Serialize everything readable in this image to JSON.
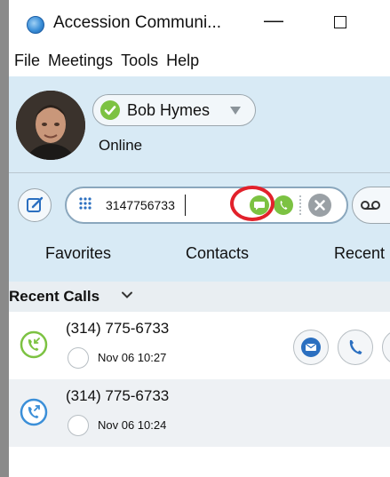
{
  "window": {
    "title": "Accession Communi..."
  },
  "menu": [
    "File",
    "Meetings",
    "Tools",
    "Help"
  ],
  "profile": {
    "name": "Bob Hymes",
    "status": "Online",
    "status_color": "#7cc242"
  },
  "dial": {
    "value": "3147756733"
  },
  "tabs": [
    "Favorites",
    "Contacts",
    "Recent"
  ],
  "recent": {
    "title": "Recent Calls",
    "calls": [
      {
        "number": "(314) 775-6733",
        "time": "Nov 06 10:27",
        "direction": "incoming-icon",
        "color": "#7cc242"
      },
      {
        "number": "(314) 775-6733",
        "time": "Nov 06 10:24",
        "direction": "outgoing-icon",
        "color": "#3b8fd8"
      }
    ]
  },
  "colors": {
    "accent_blue": "#3b8fd8",
    "highlight_red": "#e2212b",
    "panel_bg": "#d8eaf5"
  }
}
